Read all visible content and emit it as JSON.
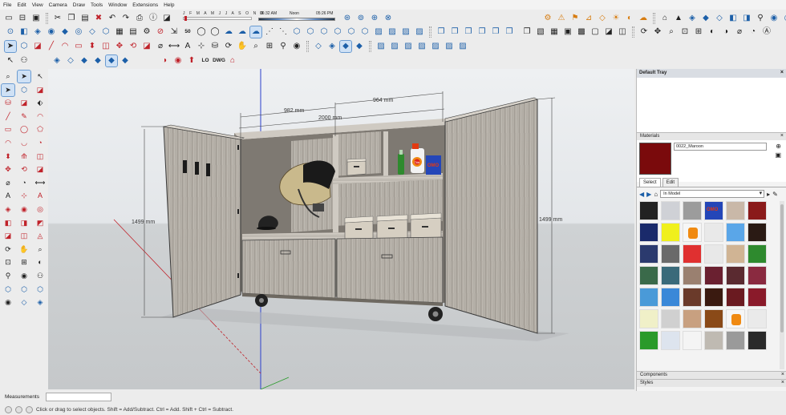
{
  "menu": [
    "File",
    "Edit",
    "View",
    "Camera",
    "Draw",
    "Tools",
    "Window",
    "Extensions",
    "Help"
  ],
  "shadows": {
    "months": "J F M A M J J A S O N D",
    "time_start": "06:32 AM",
    "time_mid": "Noon",
    "time_end": "05:26 PM"
  },
  "toolbar_labels": {
    "lo": "LO",
    "dwg": "DWG",
    "fifty": "50"
  },
  "dimensions": {
    "left_width": "982 mm",
    "right_width": "964 mm",
    "total_width": "2000 mm",
    "left_height": "1499 mm",
    "right_height": "1499 mm"
  },
  "products": {
    "detergent": "Tide",
    "box": "OMO"
  },
  "tray": {
    "title": "Default Tray",
    "materials_header": "Materials",
    "material_name": "0022_Maroon",
    "tab_select": "Select",
    "tab_edit": "Edit",
    "library": "In Model",
    "components": "Components",
    "styles": "Styles",
    "swatches": [
      "#222222",
      "#cfd1d6",
      "#9c9c9c",
      "omo",
      "#c9b8a8",
      "#8a1a1a",
      "#1a2a6b",
      "#f0f01c",
      "tide",
      "#e9e9e9",
      "#5aa6e8",
      "#2a1a14",
      "#2b3a6e",
      "#6a6a6a",
      "#e03030",
      "#e8e8e8",
      "#d0b494",
      "#2e8a2e",
      "#3a6a4a",
      "#3a6a7a",
      "#9a8070",
      "#6a2030",
      "#5a2a30",
      "#8a2a40",
      "#4a9ad8",
      "#3a88d8",
      "#6a3a2a",
      "#3a1a10",
      "#6a1a20",
      "#8a1a2a",
      "#f0f0c8",
      "#d0d0d0",
      "#c8a080",
      "#8a4a18",
      "tide",
      "#eaeaea",
      "#2a9a2a",
      "#dde4ee",
      "#f4f4f4",
      "#bfbab2",
      "#9a9a9a",
      "#2a2a2a"
    ]
  },
  "status": {
    "measurements_label": "Measurements",
    "message": "Click or drag to select objects. Shift = Add/Subtract. Ctrl = Add. Shift + Ctrl = Subtract."
  },
  "colors": {
    "accent": "#1c5fa8",
    "maroon": "#7a0a0c",
    "axis_red": "#c0222a",
    "axis_blue": "#2a3fcc",
    "axis_green": "#2a9a2a"
  }
}
